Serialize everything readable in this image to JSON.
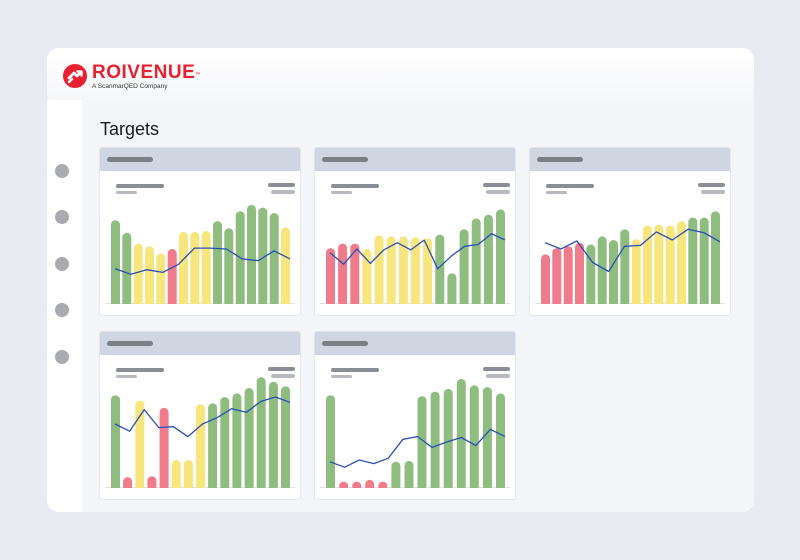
{
  "app": {
    "brand": "ROIVENUE",
    "brand_mark": "™",
    "tagline": "A ScanmarQED Company",
    "colors": {
      "brand_red": "#e8202f",
      "green": "#8fbc7f",
      "yellow": "#f7e67d",
      "red": "#ee7c8a",
      "line": "#2a4fb8"
    }
  },
  "sidebar": {
    "items": [
      "nav-item-1",
      "nav-item-2",
      "nav-item-3",
      "nav-item-4",
      "nav-item-5"
    ]
  },
  "page": {
    "title": "Targets"
  },
  "chart_data": [
    {
      "type": "bar",
      "values": [
        92,
        78,
        66,
        63,
        55,
        60,
        79,
        79,
        80,
        91,
        83,
        102,
        109,
        106,
        100,
        84
      ],
      "bar_colors": [
        "green",
        "green",
        "yellow",
        "yellow",
        "yellow",
        "red",
        "yellow",
        "yellow",
        "yellow",
        "green",
        "green",
        "green",
        "green",
        "green",
        "green",
        "yellow"
      ],
      "line": [
        38,
        32,
        37,
        34,
        43,
        61,
        61,
        60,
        49,
        47,
        58,
        49
      ]
    },
    {
      "type": "bar",
      "values": [
        61,
        66,
        66,
        60,
        75,
        74,
        74,
        73,
        72,
        76,
        33,
        82,
        94,
        98,
        104
      ],
      "bar_colors": [
        "red",
        "red",
        "red",
        "yellow",
        "yellow",
        "yellow",
        "yellow",
        "yellow",
        "yellow",
        "green",
        "green",
        "green",
        "green",
        "green",
        "green"
      ],
      "line": [
        56,
        43,
        60,
        44,
        59,
        67,
        59,
        70,
        38,
        52,
        63,
        65,
        77,
        70
      ]
    },
    {
      "type": "bar",
      "values": [
        54,
        61,
        63,
        67,
        65,
        74,
        70,
        82,
        71,
        86,
        87,
        86,
        91,
        95,
        95,
        102
      ],
      "bar_colors": [
        "red",
        "red",
        "red",
        "red",
        "green",
        "green",
        "green",
        "green",
        "yellow",
        "yellow",
        "yellow",
        "yellow",
        "yellow",
        "green",
        "green",
        "green"
      ],
      "line": [
        67,
        60,
        69,
        45,
        35,
        63,
        64,
        79,
        70,
        82,
        78,
        68
      ]
    },
    {
      "type": "bar",
      "values": [
        102,
        11,
        96,
        12,
        88,
        30,
        30,
        92,
        93,
        100,
        104,
        110,
        122,
        117,
        112
      ],
      "bar_colors": [
        "green",
        "red",
        "yellow",
        "red",
        "red",
        "yellow",
        "yellow",
        "yellow",
        "green",
        "green",
        "green",
        "green",
        "green",
        "green",
        "green"
      ],
      "line": [
        70,
        62,
        86,
        66,
        67,
        56,
        70,
        77,
        87,
        83,
        95,
        100,
        94
      ]
    },
    {
      "type": "bar",
      "values": [
        102,
        6,
        6,
        8,
        6,
        28,
        29,
        101,
        106,
        109,
        120,
        113,
        111,
        104
      ],
      "bar_colors": [
        "green",
        "red",
        "red",
        "red",
        "red",
        "green",
        "green",
        "green",
        "green",
        "green",
        "green",
        "green",
        "green",
        "green"
      ],
      "line": [
        28,
        22,
        30,
        26,
        32,
        53,
        56,
        44,
        50,
        55,
        46,
        64,
        56
      ]
    }
  ]
}
